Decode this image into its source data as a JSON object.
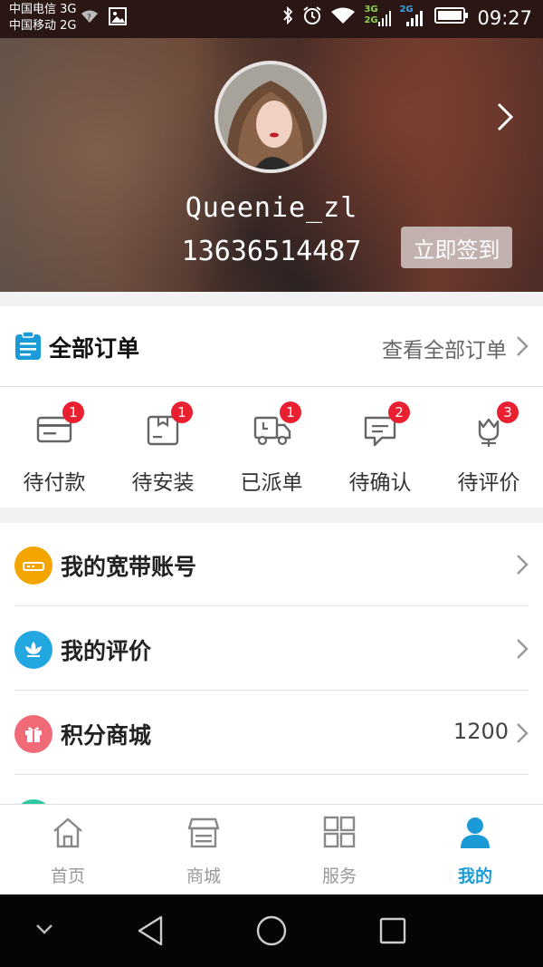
{
  "status_bar": {
    "carrier1": "中国电信 3G",
    "carrier2": "中国移动 2G",
    "net1": "3G",
    "net2": "2G",
    "net3": "2G",
    "time": "09:27"
  },
  "profile": {
    "username": "Queenie_zl",
    "phone": "13636514487",
    "signin_label": "立即签到"
  },
  "orders": {
    "title": "全部订单",
    "view_all": "查看全部订单",
    "items": [
      {
        "label": "待付款",
        "badge": "1",
        "icon": "card-icon"
      },
      {
        "label": "待安装",
        "badge": "1",
        "icon": "box-icon"
      },
      {
        "label": "已派单",
        "badge": "1",
        "icon": "truck-icon"
      },
      {
        "label": "待确认",
        "badge": "2",
        "icon": "message-icon"
      },
      {
        "label": "待评价",
        "badge": "3",
        "icon": "flower-icon"
      }
    ]
  },
  "menu": {
    "items": [
      {
        "label": "我的宽带账号",
        "value": "",
        "icon": "router-icon",
        "color": "#f5a500"
      },
      {
        "label": "我的评价",
        "value": "",
        "icon": "lotus-icon",
        "color": "#22a7e0"
      },
      {
        "label": "积分商城",
        "value": "1200",
        "icon": "gift-icon",
        "color": "#f06a78"
      }
    ],
    "partial_color": "#2cc7a3"
  },
  "tabbar": {
    "items": [
      {
        "label": "首页",
        "icon": "home-icon"
      },
      {
        "label": "商城",
        "icon": "store-icon"
      },
      {
        "label": "服务",
        "icon": "grid-icon"
      },
      {
        "label": "我的",
        "icon": "user-icon"
      }
    ],
    "active_color": "#1a9bd8",
    "inactive_color": "#999999"
  }
}
